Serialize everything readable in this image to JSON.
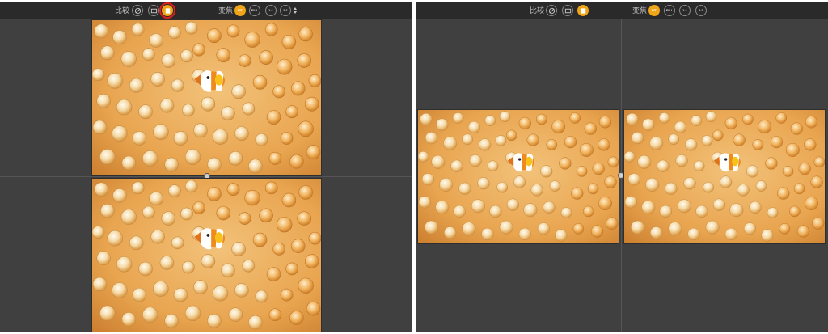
{
  "left": {
    "compare_label": "比较",
    "zoom_label": "变焦",
    "compare_modes": [
      {
        "icon": "before-after-icon",
        "active": false
      },
      {
        "icon": "split-view-icon",
        "active": false
      },
      {
        "icon": "stacked-view-icon",
        "active": true
      }
    ],
    "zoom_options": [
      {
        "label": "FIT",
        "active": true
      },
      {
        "label": "FILL",
        "active": false
      },
      {
        "label": "1:1",
        "active": false
      },
      {
        "label": "2:1",
        "active": false
      }
    ],
    "layout": "stacked"
  },
  "right": {
    "compare_label": "比较",
    "zoom_label": "变焦",
    "compare_modes": [
      {
        "icon": "before-after-icon",
        "active": false
      },
      {
        "icon": "split-view-icon",
        "active": false
      },
      {
        "icon": "stacked-view-icon",
        "active": true
      }
    ],
    "zoom_options": [
      {
        "label": "FIT",
        "active": true
      },
      {
        "label": "FILL",
        "active": false
      },
      {
        "label": "1:1",
        "active": false
      },
      {
        "label": "2:1",
        "active": false
      }
    ],
    "layout": "side-by-side"
  },
  "colors": {
    "accent": "#f0a418",
    "panel_bg": "#404040",
    "toolbar_bg": "#2a2a2a",
    "highlight": "#e11d1d"
  }
}
